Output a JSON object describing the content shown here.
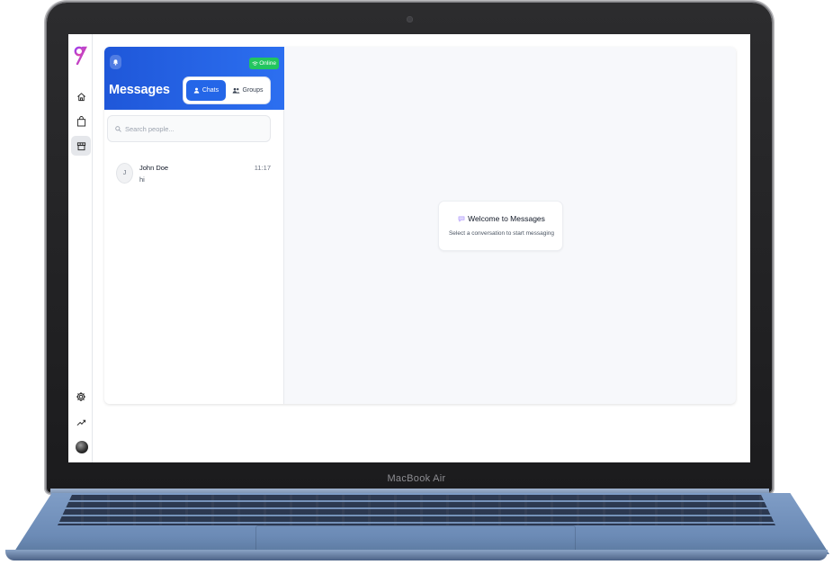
{
  "device": {
    "brand_label": "MacBook Air"
  },
  "sidebar": {
    "items": [
      {
        "icon": "home-icon"
      },
      {
        "icon": "shopping-bag-icon"
      },
      {
        "icon": "store-icon",
        "active": true
      }
    ],
    "bottom_items": [
      {
        "icon": "settings-icon"
      },
      {
        "icon": "trending-up-icon"
      },
      {
        "icon": "user-avatar"
      }
    ]
  },
  "chat_panel": {
    "title": "Messages",
    "status_label": "Online",
    "tabs": [
      {
        "label": "Chats",
        "active": true
      },
      {
        "label": "Groups",
        "active": false
      }
    ],
    "search_placeholder": "Search people...",
    "conversations": [
      {
        "initial": "J",
        "name": "John Doe",
        "time": "11:17",
        "preview": "hi"
      }
    ]
  },
  "welcome": {
    "title": "Welcome to Messages",
    "subtitle": "Select a conversation to start messaging"
  },
  "colors": {
    "header_blue": "#2466e8",
    "online_green": "#22c55e",
    "logo_purple": "#9b3ff0",
    "logo_pink": "#ec4899"
  }
}
